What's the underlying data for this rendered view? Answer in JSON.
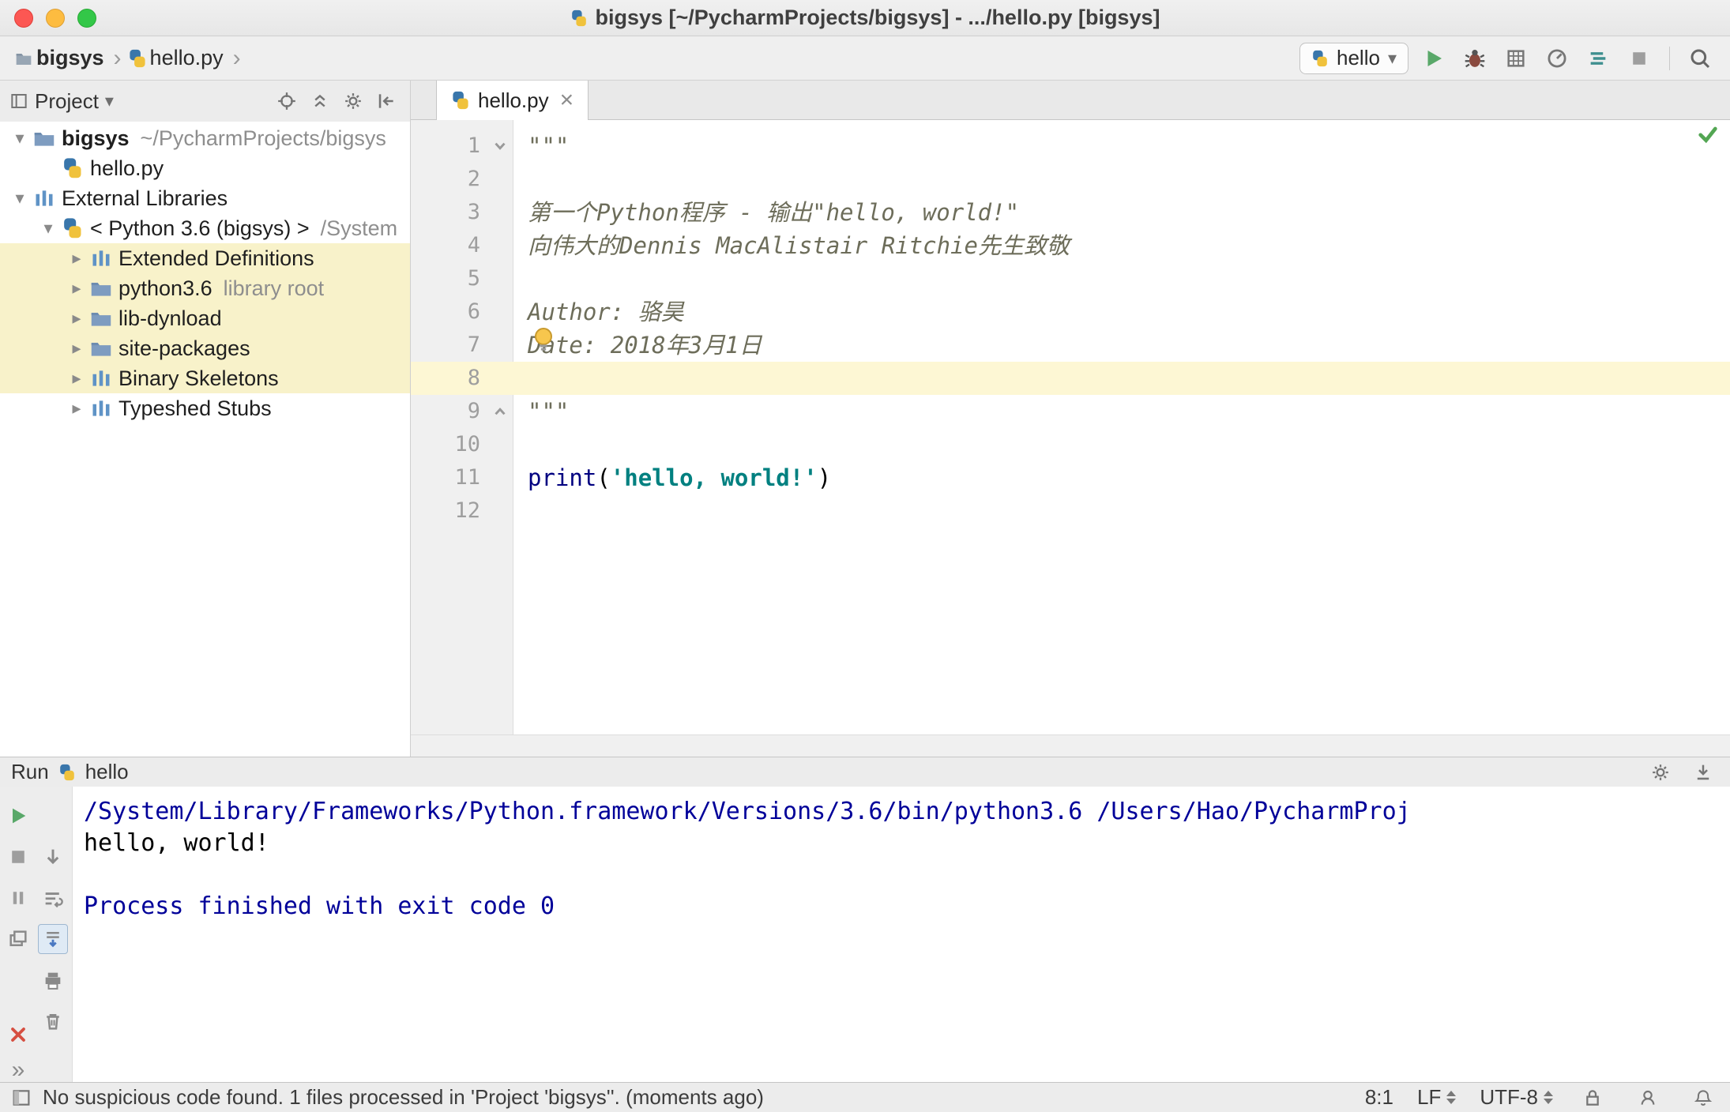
{
  "window": {
    "title": "bigsys [~/PycharmProjects/bigsys] - .../hello.py [bigsys]"
  },
  "icons": {
    "chevron_down": "▾",
    "chevron_right": "▸",
    "breadcrumb_sep": "›",
    "close": "×",
    "more": "»"
  },
  "navbar": {
    "project_crumb": "bigsys",
    "file_crumb": "hello.py",
    "run_config": "hello"
  },
  "project_panel": {
    "title": "Project",
    "tree": [
      {
        "label": "bigsys",
        "suffix": "~/PycharmProjects/bigsys",
        "icon": "folder",
        "state": "expanded",
        "level": 0,
        "bold": true
      },
      {
        "label": "hello.py",
        "icon": "pyfile",
        "state": "none",
        "level": 1
      },
      {
        "label": "External Libraries",
        "icon": "libs",
        "state": "expanded",
        "level": 0
      },
      {
        "label": "< Python 3.6 (bigsys) >",
        "suffix": "/System",
        "icon": "python",
        "state": "expanded",
        "level": 1
      },
      {
        "label": "Extended Definitions",
        "icon": "libs",
        "state": "collapsed",
        "level": 2,
        "highlighted": true
      },
      {
        "label": "python3.6",
        "suffix": "library root",
        "icon": "folder",
        "state": "collapsed",
        "level": 2,
        "highlighted": true
      },
      {
        "label": "lib-dynload",
        "icon": "folder",
        "state": "collapsed",
        "level": 2,
        "highlighted": true
      },
      {
        "label": "site-packages",
        "icon": "folder",
        "state": "collapsed",
        "level": 2,
        "highlighted": true
      },
      {
        "label": "Binary Skeletons",
        "icon": "libs",
        "state": "collapsed",
        "level": 2,
        "highlighted": true
      },
      {
        "label": "Typeshed Stubs",
        "icon": "libs",
        "state": "collapsed",
        "level": 2
      }
    ]
  },
  "editor": {
    "tab_label": "hello.py",
    "lines": [
      {
        "n": "1",
        "parts": [
          {
            "t": "\"\"\"",
            "c": "doc"
          }
        ],
        "fold": "open"
      },
      {
        "n": "2",
        "parts": []
      },
      {
        "n": "3",
        "parts": [
          {
            "t": "第一个Python程序 - 输出\"hello, world!\"",
            "c": "doc"
          }
        ]
      },
      {
        "n": "4",
        "parts": [
          {
            "t": "向伟大的Dennis MacAlistair Ritchie先生致敬",
            "c": "doc"
          }
        ]
      },
      {
        "n": "5",
        "parts": []
      },
      {
        "n": "6",
        "parts": [
          {
            "t": "Author: 骆昊",
            "c": "doc"
          }
        ]
      },
      {
        "n": "7",
        "parts": [
          {
            "t": "Date: 2018年3月1日",
            "c": "doc"
          }
        ]
      },
      {
        "n": "8",
        "parts": [],
        "current": true
      },
      {
        "n": "9",
        "parts": [
          {
            "t": "\"\"\"",
            "c": "doc"
          }
        ],
        "fold": "close"
      },
      {
        "n": "10",
        "parts": []
      },
      {
        "n": "11",
        "parts": [
          {
            "t": "print",
            "c": "builtin"
          },
          {
            "t": "(",
            "c": "plain"
          },
          {
            "t": "'hello, world!'",
            "c": "string"
          },
          {
            "t": ")",
            "c": "plain"
          }
        ]
      },
      {
        "n": "12",
        "parts": []
      }
    ]
  },
  "run_panel": {
    "title": "Run",
    "config": "hello",
    "console": [
      {
        "text": "/System/Library/Frameworks/Python.framework/Versions/3.6/bin/python3.6 /Users/Hao/PycharmProj",
        "style": "system"
      },
      {
        "text": "hello, world!",
        "style": "stdout"
      },
      {
        "text": "",
        "style": "stdout"
      },
      {
        "text": "Process finished with exit code 0",
        "style": "system"
      }
    ]
  },
  "status_bar": {
    "message": "No suspicious code found. 1 files processed in 'Project 'bigsys''. (moments ago)",
    "caret": "8:1",
    "line_sep": "LF",
    "encoding": "UTF-8"
  },
  "colors": {
    "accent_green": "#59a869",
    "builtin": "#000080",
    "string": "#008080",
    "docstring": "#6d6d5a",
    "console_system": "#000099",
    "caret_line_bg": "#fdf7d4",
    "tree_highlight_bg": "#f8f2ca"
  }
}
